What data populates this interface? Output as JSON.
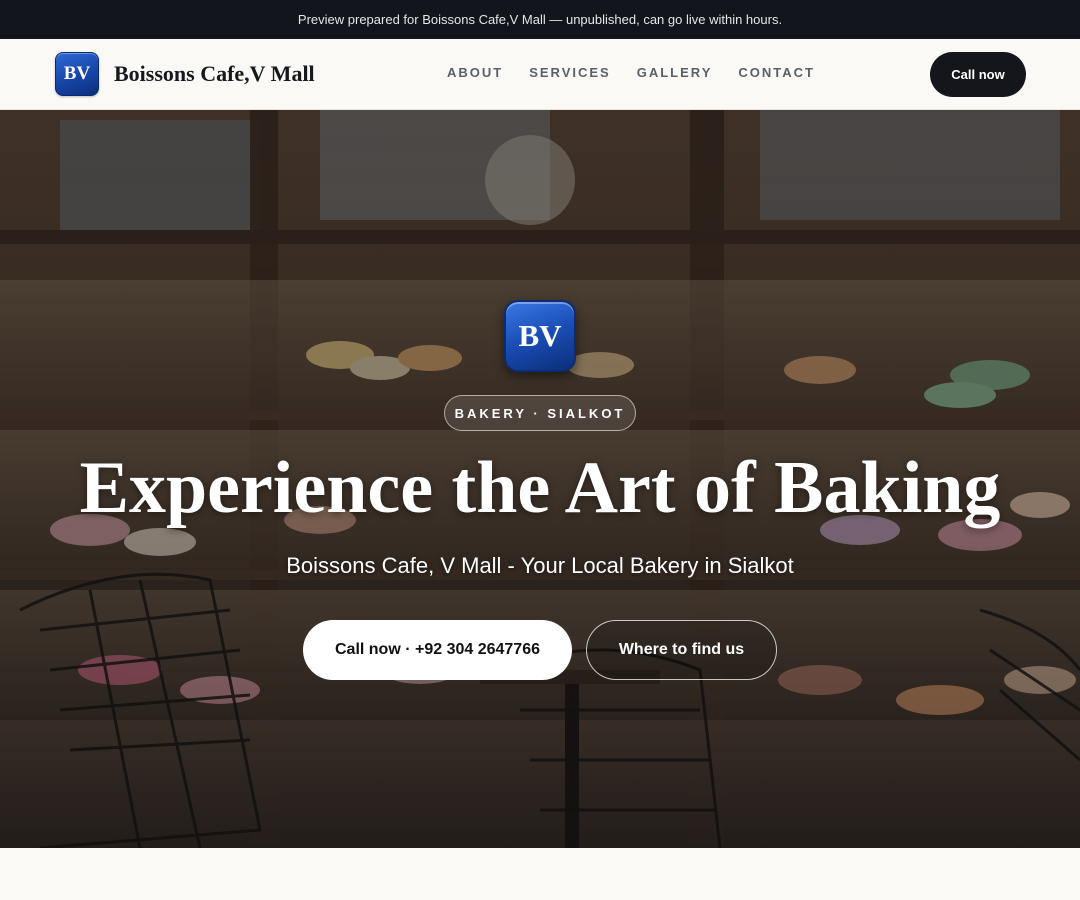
{
  "announcement": "Preview prepared for Boissons Cafe,V Mall — unpublished, can go live within hours.",
  "header": {
    "logo_text": "BV",
    "brand_name": "Boissons Cafe,V Mall",
    "nav": [
      "ABOUT",
      "SERVICES",
      "GALLERY",
      "CONTACT"
    ],
    "cta": "Call now"
  },
  "hero": {
    "logo_text": "BV",
    "badge": "BAKERY · SIALKOT",
    "title": "Experience the Art of Baking",
    "subtitle": "Boissons Cafe, V Mall - Your Local Bakery in Sialkot",
    "primary_button": "Call now · +92 304 2647766",
    "secondary_button": "Where to find us",
    "background_image": "bakery storefront window with macarons and wire chairs"
  },
  "colors": {
    "topbar": "#12151b",
    "page_bg": "#faf9f6",
    "logo_blue": "#1a4db4",
    "cta_dark": "#14161b"
  }
}
